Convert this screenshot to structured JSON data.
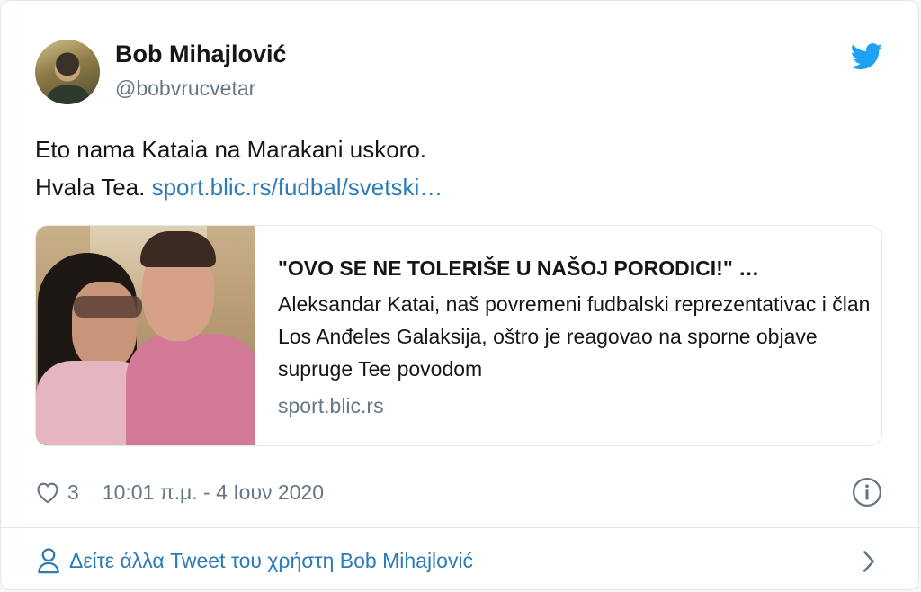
{
  "author": {
    "display_name": "Bob Mihajlović",
    "handle": "@bobvrucvetar"
  },
  "tweet": {
    "line1": "Eto nama Kataia na Marakani uskoro.",
    "line2_text": "Hvala Tea. ",
    "link": "sport.blic.rs/fudbal/svetski…"
  },
  "link_card": {
    "title": "\"OVO SE NE TOLERIŠE U NAŠOJ PORODICI!\" …",
    "description": "Aleksandar Katai, naš povremeni fudbalski reprezentativac i član Los Anđeles Galaksija, oštro je reagovao na sporne objave supruge Tee povodom",
    "domain": "sport.blic.rs"
  },
  "meta": {
    "like_count": "3",
    "timestamp": "10:01 π.μ. - 4 Ιουν 2020"
  },
  "footer": {
    "more_tweets_label": "Δείτε άλλα Tweet του χρήστη Bob Mihajlović"
  },
  "icons": {
    "brand": "twitter-bird-icon",
    "like": "heart-icon",
    "info": "info-icon",
    "user": "person-icon",
    "next": "chevron-right-icon"
  },
  "colors": {
    "brand_blue": "#1da1f2",
    "link_blue": "#2b7bb9",
    "secondary_text": "#657786",
    "border": "#e1e8ed"
  }
}
